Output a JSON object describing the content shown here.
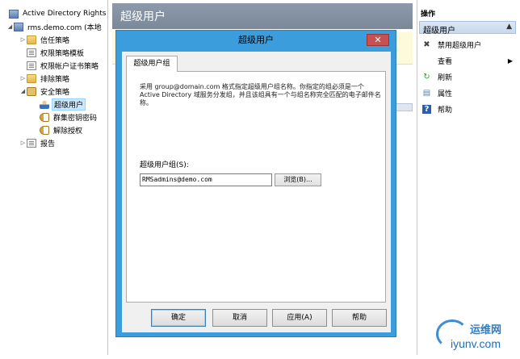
{
  "tree": {
    "items": [
      {
        "label": "Active Directory Rights",
        "icon": "server-icon",
        "toggle": ""
      },
      {
        "label": "rms.demo.com (本地",
        "icon": "server-icon",
        "toggle": "◢"
      },
      {
        "label": "信任策略",
        "icon": "folder-icon",
        "toggle": "▷"
      },
      {
        "label": "权限策略模板",
        "icon": "document-icon",
        "toggle": ""
      },
      {
        "label": "权限帐户证书策略",
        "icon": "document-icon",
        "toggle": ""
      },
      {
        "label": "排除策略",
        "icon": "folder-icon",
        "toggle": "▷"
      },
      {
        "label": "安全策略",
        "icon": "lock-icon",
        "toggle": "◢"
      },
      {
        "label": "超级用户",
        "icon": "user-icon",
        "toggle": ""
      },
      {
        "label": "群集密钥密码",
        "icon": "key-icon",
        "toggle": ""
      },
      {
        "label": "解除授权",
        "icon": "key-icon",
        "toggle": ""
      },
      {
        "label": "报告",
        "icon": "document-icon",
        "toggle": "▷"
      }
    ]
  },
  "middle": {
    "title": "超级用户"
  },
  "actions": {
    "header": "操作",
    "section": "超级用户",
    "section_arrow": "▲",
    "items": [
      {
        "label": "禁用超级用户",
        "icon": "close-icon",
        "glyph": "✖"
      },
      {
        "label": "查看",
        "icon": "view-icon",
        "glyph": "",
        "submenu": "▶"
      },
      {
        "label": "刷新",
        "icon": "refresh-icon",
        "glyph": "↻"
      },
      {
        "label": "属性",
        "icon": "properties-icon",
        "glyph": "▤"
      },
      {
        "label": "帮助",
        "icon": "help-icon",
        "glyph": "?"
      }
    ]
  },
  "dialog": {
    "title": "超级用户",
    "close_glyph": "✕",
    "tab": "超级用户组",
    "description": "采用 group@domain.com 格式指定超级用户组名称。你指定的组必须是一个 Active Directory 域服务分发组，并且该组具有一个与组名称完全匹配的电子邮件名称。",
    "field_label": "超级用户组(S):",
    "field_value": "RMSadmins@demo.com",
    "browse_label": "浏览(B)...",
    "buttons": {
      "ok": "确定",
      "cancel": "取消",
      "apply": "应用(A)",
      "help": "帮助"
    }
  },
  "watermark": {
    "name": "运维网",
    "url": "iyunv.com"
  }
}
